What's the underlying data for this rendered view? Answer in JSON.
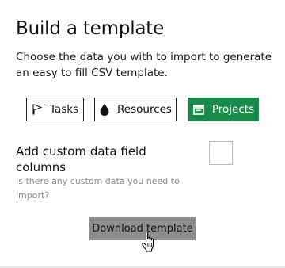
{
  "header": {
    "title": "Build a template",
    "description": "Choose the data you with to import to generate an easy to fill CSV template."
  },
  "data_types": [
    {
      "label": "Tasks",
      "icon": "flag-icon",
      "selected": false
    },
    {
      "label": "Resources",
      "icon": "drop-icon",
      "selected": false
    },
    {
      "label": "Projects",
      "icon": "project-icon",
      "selected": true
    }
  ],
  "custom_fields": {
    "label": "Add custom data field columns",
    "hint": "Is there any custom data you need to import?",
    "checked": false
  },
  "actions": {
    "download_label": "Download template"
  },
  "colors": {
    "accent": "#1a8a4c",
    "download_button": "#8e8e8e",
    "hint_text": "#8a8a8a"
  }
}
